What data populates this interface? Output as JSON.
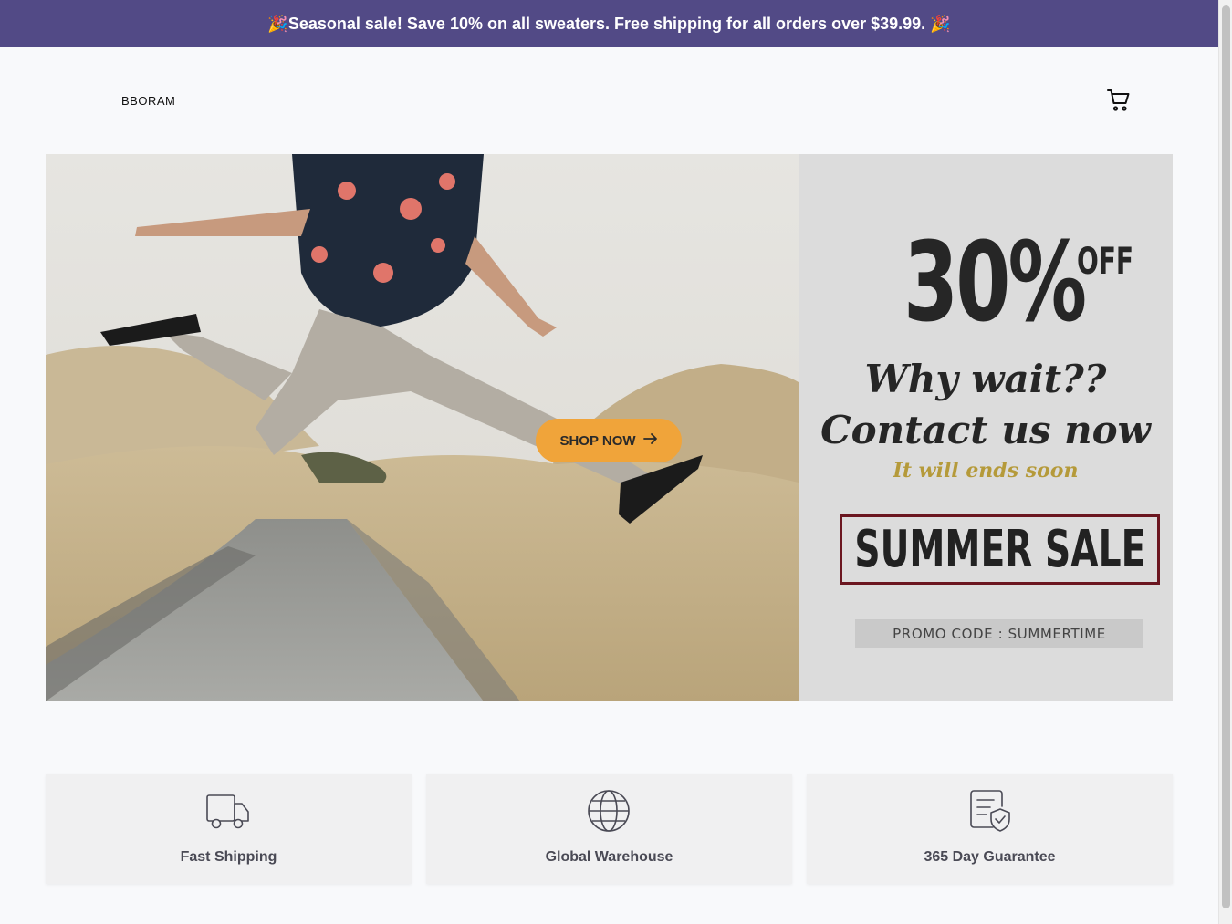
{
  "announcement": {
    "text": "🎉Seasonal sale! Save 10% on all sweaters. Free shipping for all orders over $39.99. 🎉"
  },
  "header": {
    "brand": "BBORAM",
    "cart_icon": "cart-icon"
  },
  "hero": {
    "discount": "30%",
    "off": "OFF",
    "headline_1": "Why wait??",
    "headline_2": "Contact us now",
    "tagline": "It will ends soon",
    "sale_title": "SUMMER SALE",
    "promo_code": "PROMO CODE : SUMMERTIME",
    "cta_label": "SHOP NOW",
    "cta_icon": "arrow-right-icon"
  },
  "features": [
    {
      "label": "Fast Shipping",
      "icon": "truck-icon"
    },
    {
      "label": "Global Warehouse",
      "icon": "globe-icon"
    },
    {
      "label": "365 Day Guarantee",
      "icon": "shield-check-icon"
    }
  ],
  "colors": {
    "announcement_bg": "#524a86",
    "cta_bg": "#f0a43a",
    "sale_border": "#6b1620",
    "tagline": "#b59a3a"
  }
}
